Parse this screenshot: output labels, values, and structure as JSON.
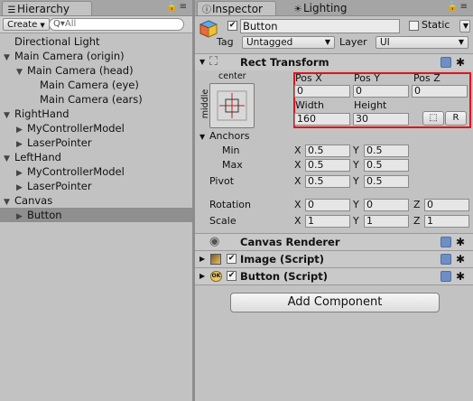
{
  "hierarchy": {
    "tab": "Hierarchy",
    "create": "Create",
    "search_prefix": "Q▾",
    "search_placeholder": "All",
    "items": [
      {
        "label": "Directional Light",
        "arrow": ""
      },
      {
        "label": "Main Camera (origin)",
        "arrow": "▼"
      },
      {
        "label": "Main Camera (head)",
        "arrow": "▼"
      },
      {
        "label": "Main Camera (eye)",
        "arrow": ""
      },
      {
        "label": "Main Camera (ears)",
        "arrow": ""
      },
      {
        "label": "RightHand",
        "arrow": "▼"
      },
      {
        "label": "MyControllerModel",
        "arrow": "▶"
      },
      {
        "label": "LaserPointer",
        "arrow": "▶"
      },
      {
        "label": "LeftHand",
        "arrow": "▼"
      },
      {
        "label": "MyControllerModel",
        "arrow": "▶"
      },
      {
        "label": "LaserPointer",
        "arrow": "▶"
      },
      {
        "label": "Canvas",
        "arrow": "▼"
      },
      {
        "label": "Button",
        "arrow": "▶",
        "selected": true
      }
    ]
  },
  "inspector": {
    "tab_inspector": "Inspector",
    "tab_lighting": "Lighting",
    "object_name": "Button",
    "static_label": "Static",
    "tag_label": "Tag",
    "tag_value": "Untagged",
    "layer_label": "Layer",
    "layer_value": "UI",
    "rect_transform": {
      "title": "Rect Transform",
      "anchor_h": "center",
      "anchor_v": "middle",
      "pos_x_label": "Pos X",
      "pos_x": "0",
      "pos_y_label": "Pos Y",
      "pos_y": "0",
      "pos_z_label": "Pos Z",
      "pos_z": "0",
      "width_label": "Width",
      "width": "160",
      "height_label": "Height",
      "height": "30",
      "blueprint_btn": "⬚",
      "raw_btn": "R",
      "anchors_label": "Anchors",
      "min_label": "Min",
      "min_x": "0.5",
      "min_y": "0.5",
      "max_label": "Max",
      "max_x": "0.5",
      "max_y": "0.5",
      "pivot_label": "Pivot",
      "pivot_x": "0.5",
      "pivot_y": "0.5",
      "rotation_label": "Rotation",
      "rot_x": "0",
      "rot_y": "0",
      "rot_z": "0",
      "scale_label": "Scale",
      "scale_x": "1",
      "scale_y": "1",
      "scale_z": "1",
      "x": "X",
      "y": "Y",
      "z": "Z"
    },
    "canvas_renderer": "Canvas Renderer",
    "image_script": "Image (Script)",
    "button_script": "Button (Script)",
    "add_component": "Add Component"
  },
  "colors": {
    "highlight": "#e0141b",
    "panel": "#c2c2c2",
    "selected_row": "#8f8f8f"
  }
}
